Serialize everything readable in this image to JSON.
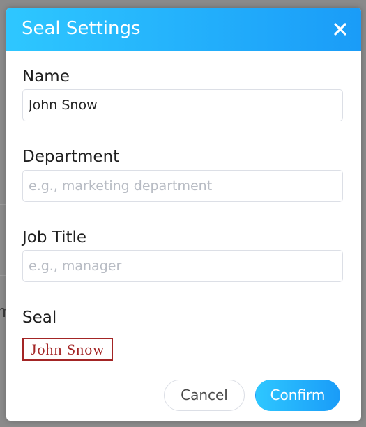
{
  "dialog": {
    "title": "Seal Settings",
    "close_icon": "close-icon"
  },
  "form": {
    "name": {
      "label": "Name",
      "value": "John Snow",
      "placeholder": ""
    },
    "department": {
      "label": "Department",
      "value": "",
      "placeholder": "e.g., marketing department"
    },
    "job_title": {
      "label": "Job Title",
      "value": "",
      "placeholder": "e.g., manager"
    },
    "seal": {
      "label": "Seal",
      "preview_text": "John Snow"
    }
  },
  "footer": {
    "cancel_label": "Cancel",
    "confirm_label": "Confirm"
  },
  "colors": {
    "header_gradient_start": "#2ec7ff",
    "header_gradient_end": "#1a9cf8",
    "seal_red": "#a32525"
  }
}
